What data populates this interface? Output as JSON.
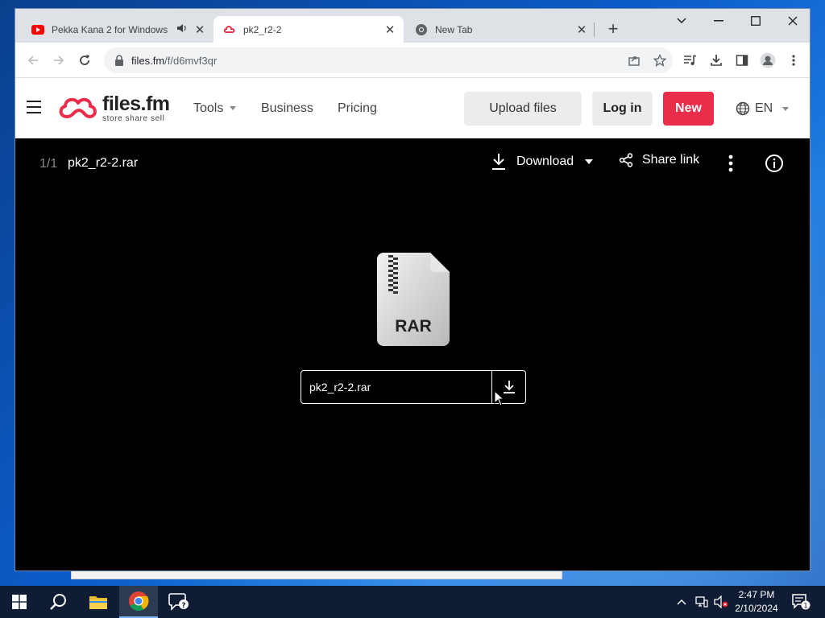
{
  "browser": {
    "tabs": [
      {
        "title": "Pekka Kana 2 for Windows",
        "favicon": "youtube-icon",
        "audio": true,
        "active": false
      },
      {
        "title": "pk2_r2-2",
        "favicon": "filesfm-icon",
        "audio": false,
        "active": true
      },
      {
        "title": "New Tab",
        "favicon": "chrome-icon",
        "audio": false,
        "active": false
      }
    ],
    "address": {
      "host": "files.fm",
      "path": "/f/d6mvf3qr"
    }
  },
  "site": {
    "logo": {
      "name": "files.fm",
      "tagline": "store share sell"
    },
    "nav": [
      {
        "label": "Tools",
        "has_dropdown": true
      },
      {
        "label": "Business",
        "has_dropdown": false
      },
      {
        "label": "Pricing",
        "has_dropdown": false
      }
    ],
    "buttons": {
      "upload": "Upload files",
      "login": "Log in",
      "new": "New"
    },
    "language": "EN",
    "brand_color": "#ea2d4b"
  },
  "viewer": {
    "counter": "1/1",
    "filename": "pk2_r2-2.rar",
    "download_label": "Download",
    "share_label": "Share link",
    "file_type_label": "RAR",
    "file_box_name": "pk2_r2-2.rar"
  },
  "taskbar": {
    "time": "2:47 PM",
    "date": "2/10/2024",
    "notifications": "1"
  }
}
